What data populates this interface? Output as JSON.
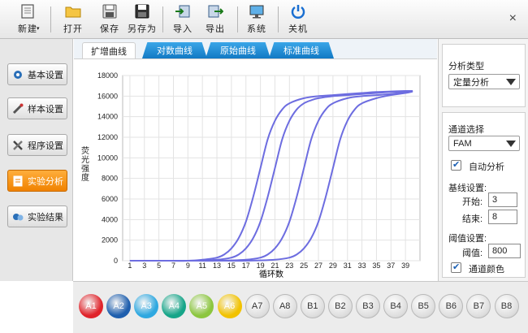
{
  "toolbar": {
    "buttons": [
      {
        "key": "new",
        "label": "新建",
        "icon": "new-file-icon"
      },
      {
        "key": "open",
        "label": "打开",
        "icon": "folder-icon"
      },
      {
        "key": "save",
        "label": "保存",
        "icon": "save-icon"
      },
      {
        "key": "save_as",
        "label": "另存为",
        "icon": "save-as-icon"
      },
      {
        "key": "import",
        "label": "导入",
        "icon": "import-icon"
      },
      {
        "key": "export",
        "label": "导出",
        "icon": "export-icon"
      },
      {
        "key": "system",
        "label": "系统",
        "icon": "monitor-icon"
      },
      {
        "key": "shutdown",
        "label": "关机",
        "icon": "power-icon"
      }
    ],
    "close_glyph": "×"
  },
  "sidebar": {
    "items": [
      {
        "label": "基本设置",
        "icon": "gear-icon",
        "active": false
      },
      {
        "label": "样本设置",
        "icon": "pipette-icon",
        "active": false
      },
      {
        "label": "程序设置",
        "icon": "tools-icon",
        "active": false
      },
      {
        "label": "实验分析",
        "icon": "analysis-icon",
        "active": true
      },
      {
        "label": "实验结果",
        "icon": "results-icon",
        "active": false
      }
    ]
  },
  "tabs": [
    {
      "label": "扩增曲线",
      "active": true
    },
    {
      "label": "对数曲线",
      "active": false
    },
    {
      "label": "原始曲线",
      "active": false
    },
    {
      "label": "标准曲线",
      "active": false
    }
  ],
  "right_panel": {
    "analysis_type_label": "分析类型",
    "analysis_type_value": "定量分析",
    "channel_label": "通道选择",
    "channel_value": "FAM",
    "auto_analysis_label": "自动分析",
    "auto_analysis_checked": true,
    "baseline_label": "基线设置:",
    "start_label": "开始:",
    "start_value": "3",
    "end_label": "结束:",
    "end_value": "8",
    "threshold_label": "阈值设置:",
    "threshold_value_label": "阈值:",
    "threshold_value": "800",
    "channel_color_label": "通道颜色",
    "channel_color_checked": true
  },
  "wells": [
    {
      "label": "A1",
      "color": "#e0242b"
    },
    {
      "label": "A2",
      "color": "#1f5fae"
    },
    {
      "label": "A3",
      "color": "#2fa8e0"
    },
    {
      "label": "A4",
      "color": "#17a589"
    },
    {
      "label": "A5",
      "color": "#8cc63f"
    },
    {
      "label": "A6",
      "color": "#f2c200"
    },
    {
      "label": "A7",
      "color": ""
    },
    {
      "label": "A8",
      "color": ""
    },
    {
      "label": "B1",
      "color": ""
    },
    {
      "label": "B2",
      "color": ""
    },
    {
      "label": "B3",
      "color": ""
    },
    {
      "label": "B4",
      "color": ""
    },
    {
      "label": "B5",
      "color": ""
    },
    {
      "label": "B6",
      "color": ""
    },
    {
      "label": "B7",
      "color": ""
    },
    {
      "label": "B8",
      "color": ""
    }
  ],
  "chart_data": {
    "type": "line",
    "title": "",
    "xlabel": "循环数",
    "ylabel": "荧光强度",
    "xlim": [
      0,
      41
    ],
    "ylim": [
      0,
      18000
    ],
    "x_ticks": [
      1,
      3,
      5,
      7,
      9,
      11,
      13,
      15,
      17,
      19,
      21,
      23,
      25,
      27,
      29,
      31,
      33,
      35,
      37,
      39
    ],
    "y_ticks": [
      0,
      2000,
      4000,
      6000,
      8000,
      10000,
      12000,
      14000,
      16000,
      18000
    ],
    "grid": true,
    "line_color": "#6d6de0",
    "series": [
      {
        "x": [
          1,
          5,
          9,
          11,
          13,
          14,
          15,
          16,
          17,
          18,
          19,
          20,
          21,
          22,
          23,
          25,
          27,
          29,
          31,
          33,
          35,
          37,
          39,
          40
        ],
        "y": [
          0,
          0,
          0,
          100,
          300,
          600,
          1200,
          2200,
          3800,
          6200,
          9000,
          11800,
          13600,
          14700,
          15300,
          15800,
          16000,
          16100,
          16200,
          16300,
          16400,
          16450,
          16500,
          16500
        ]
      },
      {
        "x": [
          1,
          5,
          9,
          13,
          15,
          16,
          17,
          18,
          19,
          20,
          21,
          22,
          23,
          24,
          25,
          26,
          27,
          29,
          31,
          33,
          35,
          37,
          39,
          40
        ],
        "y": [
          0,
          0,
          0,
          100,
          300,
          600,
          1200,
          2200,
          3800,
          6200,
          9000,
          11800,
          13600,
          14700,
          15300,
          15600,
          15800,
          16000,
          16100,
          16200,
          16300,
          16400,
          16450,
          16500
        ]
      },
      {
        "x": [
          1,
          5,
          9,
          13,
          17,
          19,
          20,
          21,
          22,
          23,
          24,
          25,
          26,
          27,
          28,
          29,
          31,
          33,
          35,
          37,
          39,
          40
        ],
        "y": [
          0,
          0,
          0,
          0,
          100,
          300,
          600,
          1200,
          2200,
          3800,
          6200,
          9000,
          11800,
          13600,
          14700,
          15300,
          15800,
          16000,
          16100,
          16200,
          16400,
          16500
        ]
      },
      {
        "x": [
          1,
          5,
          9,
          13,
          17,
          21,
          23,
          24,
          25,
          26,
          27,
          28,
          29,
          30,
          31,
          32,
          33,
          35,
          37,
          39,
          40
        ],
        "y": [
          0,
          0,
          0,
          0,
          0,
          100,
          300,
          600,
          1200,
          2200,
          3800,
          6200,
          9000,
          11800,
          13600,
          14700,
          15300,
          15800,
          16100,
          16300,
          16450
        ]
      }
    ]
  }
}
